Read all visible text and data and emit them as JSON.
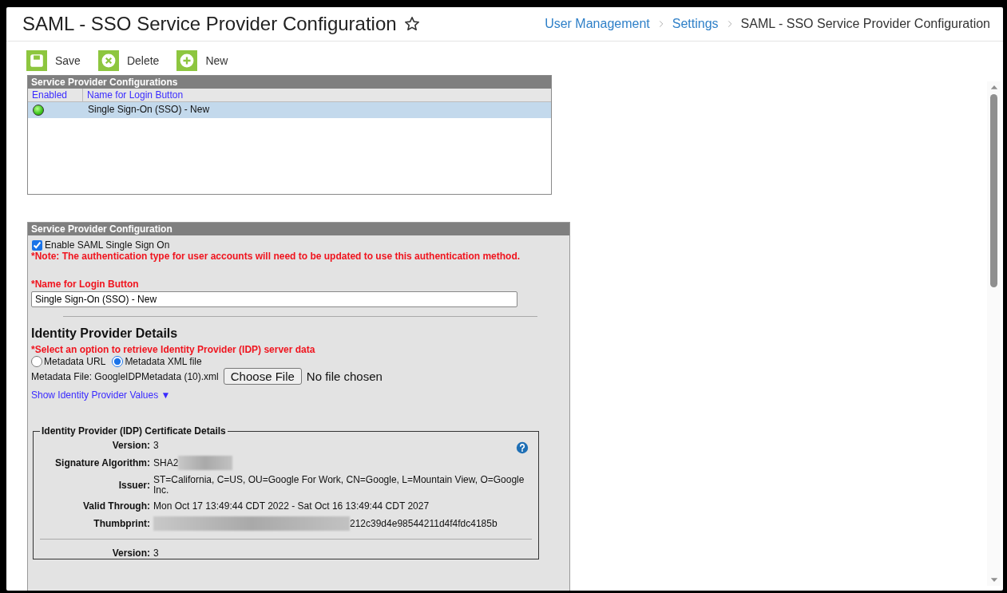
{
  "header": {
    "title": "SAML - SSO Service Provider Configuration",
    "favorite": false,
    "breadcrumb": [
      {
        "label": "User Management",
        "kind": "link"
      },
      {
        "label": "Settings",
        "kind": "link"
      },
      {
        "label": "SAML - SSO Service Provider Configuration",
        "kind": "current"
      }
    ]
  },
  "toolbar": [
    {
      "label": "Save",
      "kind": "save"
    },
    {
      "label": "Delete",
      "kind": "delete"
    },
    {
      "label": "New",
      "kind": "new"
    }
  ],
  "list_panel": {
    "title": "Service Provider Configurations",
    "columns": [
      "Enabled",
      "Name for Login Button"
    ],
    "rows": [
      {
        "enabled": true,
        "name": "Single Sign-On (SSO) - New",
        "selected": true
      }
    ]
  },
  "config_panel": {
    "title": "Service Provider Configuration",
    "enable_checkbox": {
      "label": "Enable SAML Single Sign On",
      "checked": true
    },
    "note": "*Note: The authentication type for user accounts will need to be updated to use this authentication method.",
    "name_field": {
      "label": "*Name for Login Button",
      "value": "Single Sign-On (SSO) - New"
    },
    "idp_heading": "Identity Provider Details",
    "idp_prompt": "*Select an option to retrieve Identity Provider (IDP) server data",
    "options": [
      {
        "label": "Metadata URL",
        "selected": false
      },
      {
        "label": "Metadata XML file",
        "selected": true
      }
    ],
    "metadata_file_label": "Metadata File: GoogleIDPMetadata (10).xml",
    "choose_file": "Choose File",
    "file_status": "No file chosen",
    "show_values_link": "Show Identity Provider Values ▼",
    "certificate": {
      "legend": "Identity Provider (IDP) Certificate Details",
      "entries": [
        [
          {
            "label": "Version:",
            "value": "3"
          },
          {
            "label": "Signature Algorithm:",
            "value": "SHA2",
            "redacted_after": true
          },
          {
            "label": "Issuer:",
            "value": "ST=California, C=US, OU=Google For Work, CN=Google, L=Mountain View, O=Google Inc."
          },
          {
            "label": "Valid Through:",
            "value": "Mon Oct 17 13:49:44 CDT 2022 - Sat Oct 16 13:49:44 CDT 2027"
          },
          {
            "label": "Thumbprint:",
            "value": "212c39d4e98544211d4f4fdc4185b",
            "redacted_before": true
          }
        ],
        [
          {
            "label": "Version:",
            "value": "3"
          }
        ]
      ]
    }
  }
}
